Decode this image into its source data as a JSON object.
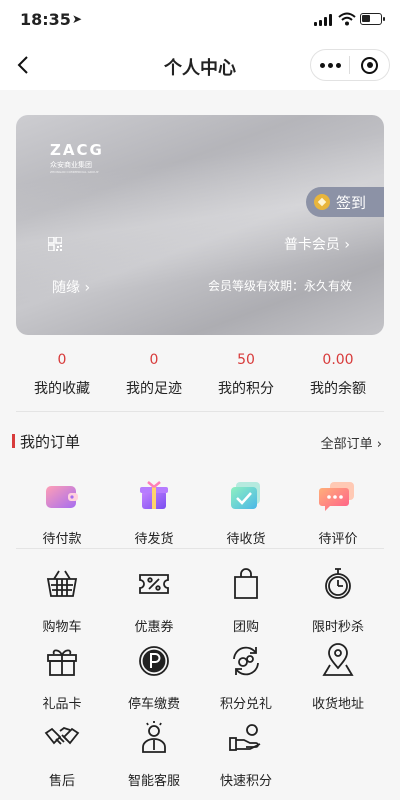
{
  "status_bar": {
    "time": "18:35"
  },
  "nav": {
    "title": "个人中心"
  },
  "card": {
    "brand": "ZACG",
    "brand_cn": "众安商业集团",
    "brand_en": "ZHONGAN COMMERCIAL GROUP",
    "signin_label": "签到",
    "member_level": "普卡会员 ›",
    "username": "随缘 ›",
    "validity": "会员等级有效期：永久有效"
  },
  "stats": [
    {
      "value": "0",
      "label": "我的收藏"
    },
    {
      "value": "0",
      "label": "我的足迹"
    },
    {
      "value": "50",
      "label": "我的积分"
    },
    {
      "value": "0.00",
      "label": "我的余额"
    }
  ],
  "orders": {
    "title": "我的订单",
    "all_label": "全部订单 ›",
    "items": [
      {
        "label": "待付款",
        "icon": "wallet-icon"
      },
      {
        "label": "待发货",
        "icon": "gift-box-icon"
      },
      {
        "label": "待收货",
        "icon": "received-check-icon"
      },
      {
        "label": "待评价",
        "icon": "chat-bubble-icon"
      }
    ]
  },
  "services": [
    {
      "label": "购物车",
      "icon": "basket-icon"
    },
    {
      "label": "优惠券",
      "icon": "coupon-icon"
    },
    {
      "label": "团购",
      "icon": "shopping-bag-icon"
    },
    {
      "label": "限时秒杀",
      "icon": "stopwatch-icon"
    },
    {
      "label": "礼品卡",
      "icon": "gift-card-icon"
    },
    {
      "label": "停车缴费",
      "icon": "parking-icon"
    },
    {
      "label": "积分兑礼",
      "icon": "points-exchange-icon"
    },
    {
      "label": "收货地址",
      "icon": "map-pin-icon"
    },
    {
      "label": "售后",
      "icon": "handshake-icon"
    },
    {
      "label": "智能客服",
      "icon": "customer-service-icon"
    },
    {
      "label": "快速积分",
      "icon": "hand-coin-icon"
    }
  ],
  "colors": {
    "accent": "#d83b3b",
    "card_tag": "#8c92a6"
  }
}
